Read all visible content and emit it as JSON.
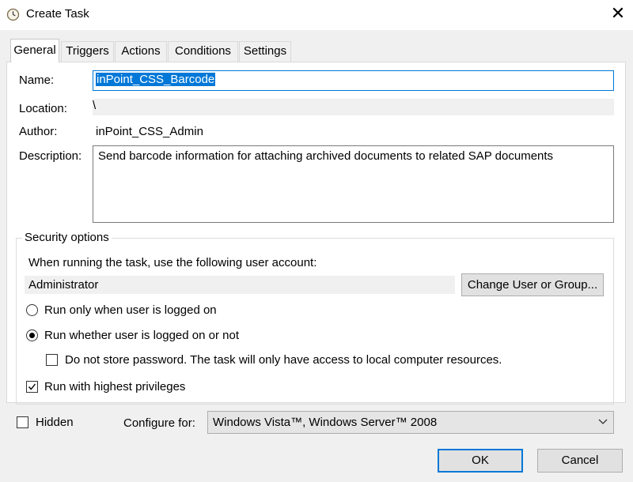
{
  "window": {
    "title": "Create Task",
    "close_glyph": "✕"
  },
  "tabs": [
    {
      "label": "General",
      "active": true
    },
    {
      "label": "Triggers"
    },
    {
      "label": "Actions"
    },
    {
      "label": "Conditions"
    },
    {
      "label": "Settings"
    }
  ],
  "general": {
    "name_label": "Name:",
    "name_value": "inPoint_CSS_Barcode",
    "location_label": "Location:",
    "location_value": "\\",
    "author_label": "Author:",
    "author_value": "inPoint_CSS_Admin",
    "description_label": "Description:",
    "description_value": "Send barcode information for attaching archived documents to related SAP documents"
  },
  "security": {
    "legend": "Security options",
    "account_prompt": "When running the task, use the following user account:",
    "account_value": "Administrator",
    "change_button": "Change User or Group...",
    "radio_logged_on": "Run only when user is logged on",
    "radio_whether": "Run whether user is logged on or not",
    "selected_radio": "whether",
    "no_store_password": "Do not store password.  The task will only have access to local computer resources.",
    "no_store_password_checked": false,
    "highest_privileges": "Run with highest privileges",
    "highest_privileges_checked": true
  },
  "footer": {
    "hidden_label": "Hidden",
    "hidden_checked": false,
    "configure_label": "Configure for:",
    "configure_value": "Windows Vista™, Windows Server™ 2008",
    "ok_label": "OK",
    "cancel_label": "Cancel"
  },
  "colors": {
    "accent": "#0078d7",
    "dialog_bg": "#f0f0f0"
  }
}
